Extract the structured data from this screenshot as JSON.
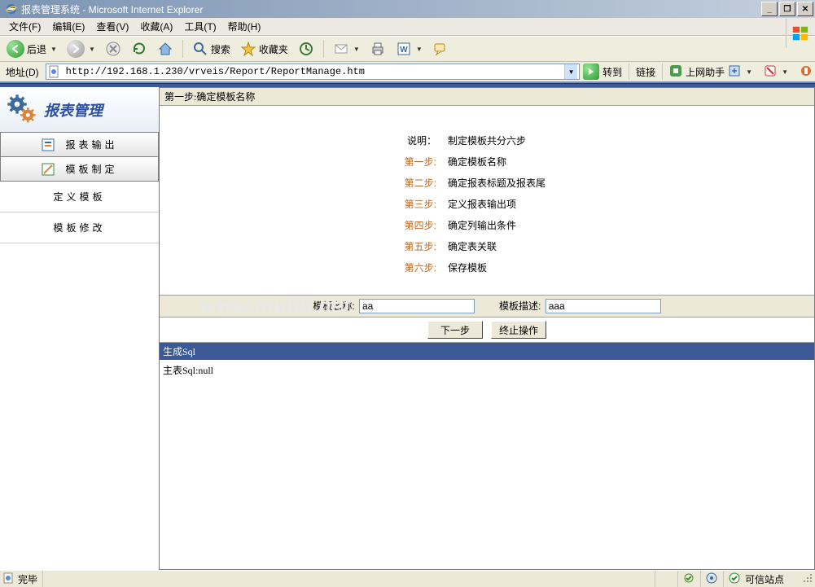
{
  "window": {
    "title": "报表管理系统 - Microsoft Internet Explorer"
  },
  "menu": {
    "file": "文件(F)",
    "edit": "编辑(E)",
    "view": "查看(V)",
    "fav": "收藏(A)",
    "tools": "工具(T)",
    "help": "帮助(H)"
  },
  "toolbar": {
    "back": "后退",
    "search": "搜索",
    "fav": "收藏夹"
  },
  "addr": {
    "label": "地址(D)",
    "url": "http://192.168.1.230/vrveis/Report/ReportManage.htm",
    "go": "转到",
    "links": "链接",
    "helper": "上网助手"
  },
  "sidebar": {
    "title": "报表管理",
    "btn_output": "报表输出",
    "btn_design": "模板制定",
    "sub_define": "定义模板",
    "sub_modify": "模板修改"
  },
  "main": {
    "step_title": "第一步:确定模板名称",
    "desc_label": "说明：",
    "desc_value": "制定模板共分六步",
    "steps": [
      {
        "k": "第一步:",
        "v": "确定模板名称"
      },
      {
        "k": "第二步:",
        "v": "确定报表标题及报表尾"
      },
      {
        "k": "第三步:",
        "v": "定义报表输出项"
      },
      {
        "k": "第四步:",
        "v": "确定列输出条件"
      },
      {
        "k": "第五步:",
        "v": "确定表关联"
      },
      {
        "k": "第六步:",
        "v": "保存模板"
      }
    ],
    "form": {
      "name_label": "模板名称:",
      "name_value": "aa",
      "desc_label": "模板描述:",
      "desc_value": "aaa"
    },
    "btn_next": "下一步",
    "btn_stop": "终止操作",
    "sql_header": "生成Sql",
    "sql_body": "主表Sql:null"
  },
  "status": {
    "done": "完毕",
    "trust": "可信站点"
  },
  "watermark": "www.niubb.net"
}
